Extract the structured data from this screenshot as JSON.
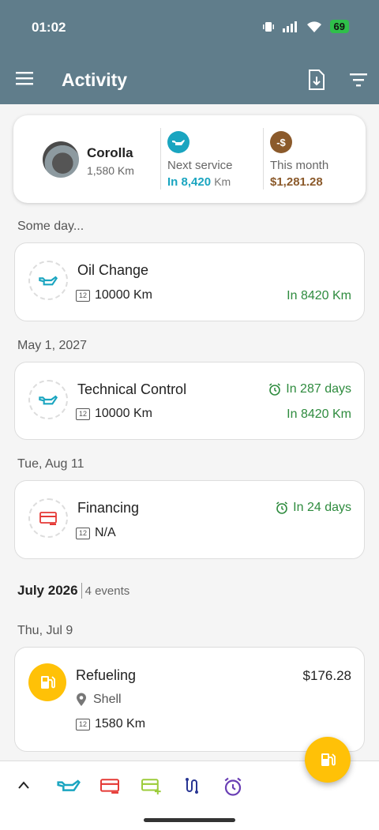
{
  "status_bar": {
    "time": "01:02",
    "battery": "69"
  },
  "app_bar": {
    "title": "Activity"
  },
  "summary": {
    "car_name": "Corolla",
    "car_km": "1,580 Km",
    "next_service_label": "Next service",
    "next_service_value": "In 8,420",
    "next_service_unit": "Km",
    "this_month_label": "This month",
    "this_month_value": "$1,281.28",
    "money_icon_text": "-$"
  },
  "sections": {
    "some_day": "Some day...",
    "may": "May 1, 2027",
    "aug": "Tue, Aug 11",
    "jul9": "Thu, Jul 9"
  },
  "month": {
    "title": "July 2026",
    "count": "4 events"
  },
  "events": {
    "oil": {
      "title": "Oil Change",
      "odometer": "10000 Km",
      "due_km": "In 8420 Km"
    },
    "technical": {
      "title": "Technical Control",
      "odometer": "10000 Km",
      "due_days": "In 287 days",
      "due_km": "In 8420 Km"
    },
    "financing": {
      "title": "Financing",
      "odometer": "N/A",
      "due_days": "In 24 days"
    },
    "refuel": {
      "title": "Refueling",
      "price": "$176.28",
      "location": "Shell",
      "odometer": "1580 Km"
    }
  },
  "colors": {
    "app_bar": "#607d8b",
    "service_teal": "#1aa5c0",
    "money_brown": "#8b5a2b",
    "due_green": "#2e8b3e",
    "finance_red": "#e53935",
    "fuel_amber": "#ffc107"
  },
  "icons": [
    "menu-icon",
    "export-icon",
    "filter-icon",
    "oil-can-icon",
    "finance-card-icon",
    "fuel-pump-icon",
    "alarm-icon",
    "location-pin-icon",
    "odometer-icon",
    "chevron-up-icon",
    "income-card-icon",
    "route-icon"
  ]
}
